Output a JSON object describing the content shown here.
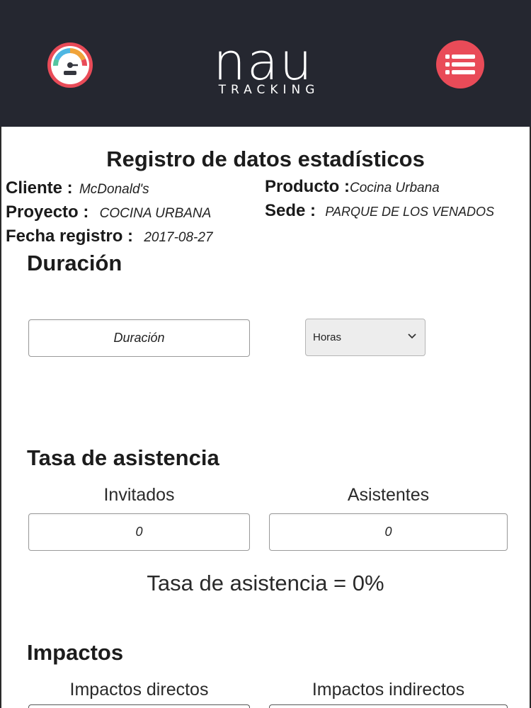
{
  "header": {
    "logo_main": "nau",
    "logo_sub": "TRACKING",
    "gauge_icon": "speedometer-icon",
    "menu_icon": "list-icon",
    "colors": {
      "bar": "#252730",
      "accent": "#e94b58"
    }
  },
  "title": "Registro de datos estadísticos",
  "info": {
    "cliente_label": "Cliente :",
    "cliente_value": "McDonald's",
    "producto_label": "Producto :",
    "producto_value": "Cocina Urbana",
    "proyecto_label": "Proyecto :",
    "proyecto_value": "COCINA URBANA",
    "sede_label": "Sede :",
    "sede_value": "PARQUE DE LOS VENADOS",
    "fecha_label": "Fecha registro :",
    "fecha_value": "2017-08-27"
  },
  "duracion": {
    "title": "Duración",
    "input_placeholder": "Duración",
    "unit_selected": "Horas"
  },
  "asistencia": {
    "title": "Tasa de asistencia",
    "invitados_label": "Invitados",
    "invitados_value": "0",
    "asistentes_label": "Asistentes",
    "asistentes_value": "0",
    "rate_text": "Tasa de asistencia = 0%"
  },
  "impactos": {
    "title": "Impactos",
    "directos_label": "Impactos directos",
    "indirectos_label": "Impactos indirectos"
  }
}
